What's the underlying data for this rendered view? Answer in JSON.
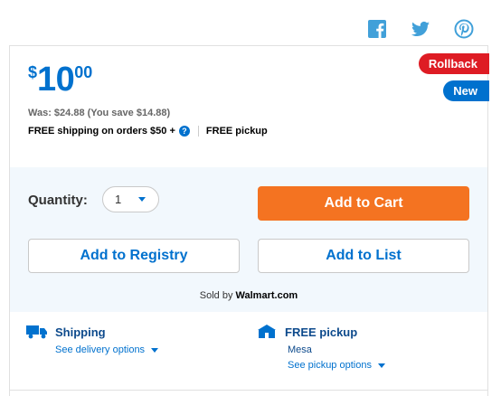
{
  "social": {
    "icons": [
      "facebook-icon",
      "twitter-icon",
      "pinterest-icon"
    ],
    "color": "#41a0d9"
  },
  "price": {
    "currency": "$",
    "dollars": "10",
    "cents": "00",
    "was": "Was: $24.88  (You save $14.88)"
  },
  "badges": {
    "rollback": "Rollback",
    "new": "New"
  },
  "shipping_line": {
    "free_shipping": "FREE shipping on orders $50 +",
    "help": "?",
    "free_pickup": "FREE pickup"
  },
  "purchase": {
    "quantity_label": "Quantity:",
    "quantity_value": "1",
    "add_to_cart": "Add to Cart",
    "add_to_registry": "Add to Registry",
    "add_to_list": "Add to List",
    "sold_by_prefix": "Sold by ",
    "sold_by_seller": "Walmart.com"
  },
  "fulfillment": {
    "shipping": {
      "title": "Shipping",
      "link": "See delivery options"
    },
    "pickup": {
      "title": "FREE pickup",
      "store": "Mesa",
      "link": "See pickup options"
    }
  },
  "colors": {
    "brand_blue": "#0071ce",
    "dark_blue": "#0d4a8c",
    "rollback_red": "#de1c24",
    "cart_orange": "#f47321",
    "panel_bg": "#f2f8fd"
  }
}
